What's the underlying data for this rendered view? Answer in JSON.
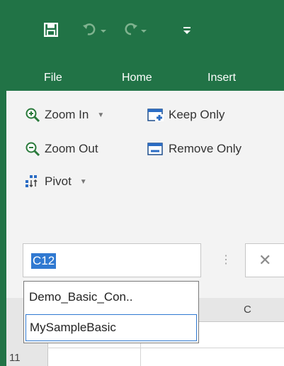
{
  "qat": {
    "save_icon": "save-icon",
    "undo_icon": "undo-icon",
    "redo_icon": "redo-icon",
    "customize_icon": "customize-qat-icon"
  },
  "tabs": [
    {
      "label": "File"
    },
    {
      "label": "Home"
    },
    {
      "label": "Insert"
    }
  ],
  "ribbon": {
    "zoom_in": "Zoom In",
    "keep_only": "Keep Only",
    "zoom_out": "Zoom Out",
    "remove_only": "Remove Only",
    "pivot": "Pivot"
  },
  "name_box": {
    "value": "C12"
  },
  "dropdown": {
    "options": [
      {
        "label": "Demo_Basic_Con.."
      },
      {
        "label": "MySampleBasic"
      }
    ]
  },
  "sheet": {
    "column_label": "C",
    "row_label": "11"
  },
  "colors": {
    "excel_green": "#217346",
    "selection_blue": "#3079d1",
    "ribbon_bg": "#f3f3f3"
  }
}
